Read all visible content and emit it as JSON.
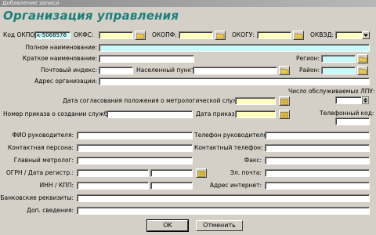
{
  "window": {
    "title": "Добавление записи"
  },
  "form": {
    "heading": "Организация управления",
    "labels": {
      "okpo": "Код ОКПО:",
      "okfs": "ОКФС:",
      "okopf": "ОКОПФ:",
      "okogu": "ОКОГУ:",
      "okved": "ОКВЭД:",
      "full_name": "Полное наименование:",
      "short_name": "Краткое наименование:",
      "region": "Регион:",
      "postal_index": "Почтовый индекс:",
      "locality": "Населенный пункт:",
      "district": "Район:",
      "address": "Адрес организации:",
      "lpu_count": "Число обслуживаемых ЛПУ:",
      "approval_date": "Дата согласования положения о метрологической службе:",
      "order_number": "Номер приказа о создании службы:",
      "order_date": "Дата приказа:",
      "phone_code": "Телефонный код:",
      "head_name": "ФИО руководителя:",
      "head_phone": "Телефон руководителя:",
      "contact_person": "Контактная персона:",
      "contact_phone": "Контактный телефон:",
      "chief_metrologist": "Главный метролог:",
      "fax": "Факс:",
      "ogrn": "ОГРН / Дата регистр.:",
      "email": "Эл. почта:",
      "inn_kpp": "ИНН / КПП:",
      "website": "Адрес интернет:",
      "bank": "Банковские реквизиты:",
      "extra": "Доп. сведения:"
    },
    "values": {
      "okpo": "к-5068576"
    }
  },
  "buttons": {
    "ok": "OK",
    "cancel": "Отменить"
  },
  "colors": {
    "heading": "#1d7f7a",
    "required": "#ffffc0",
    "lookup": "#c8f8f8"
  }
}
